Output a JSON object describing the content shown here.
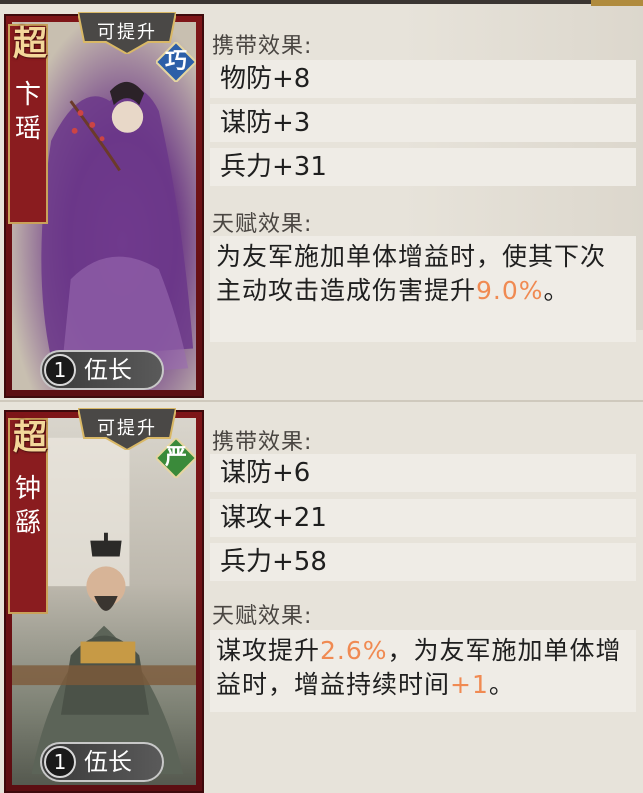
{
  "generals": [
    {
      "grade": "超",
      "name": "卞瑶",
      "upgrade_label": "可提升",
      "type_badge": "巧",
      "type_color": "#2c5fa8",
      "rank_level": "1",
      "rank_title": "伍长",
      "carry_title": "携带效果:",
      "stats": [
        "物防+8",
        "谋防+3",
        "兵力+31"
      ],
      "talent_title": "天赋效果:",
      "talent": {
        "before": "为友军施加单体增益时，使其下次主动攻击造成伤害提升",
        "value1": "9.0%",
        "middle": "。",
        "value2": "",
        "after": ""
      }
    },
    {
      "grade": "超",
      "name": "钟繇",
      "upgrade_label": "可提升",
      "type_badge": "严",
      "type_color": "#3a8a3a",
      "rank_level": "1",
      "rank_title": "伍长",
      "carry_title": "携带效果:",
      "stats": [
        "谋防+6",
        "谋攻+21",
        "兵力+58"
      ],
      "talent_title": "天赋效果:",
      "talent": {
        "before": "谋攻提升",
        "value1": "2.6%",
        "middle": "，为友军施加单体增益时，增益持续时间",
        "value2": "+1",
        "after": "。"
      }
    }
  ],
  "colors": {
    "highlight": "#f08a52",
    "card_frame": "#7e1518",
    "background": "#e7e3da"
  }
}
